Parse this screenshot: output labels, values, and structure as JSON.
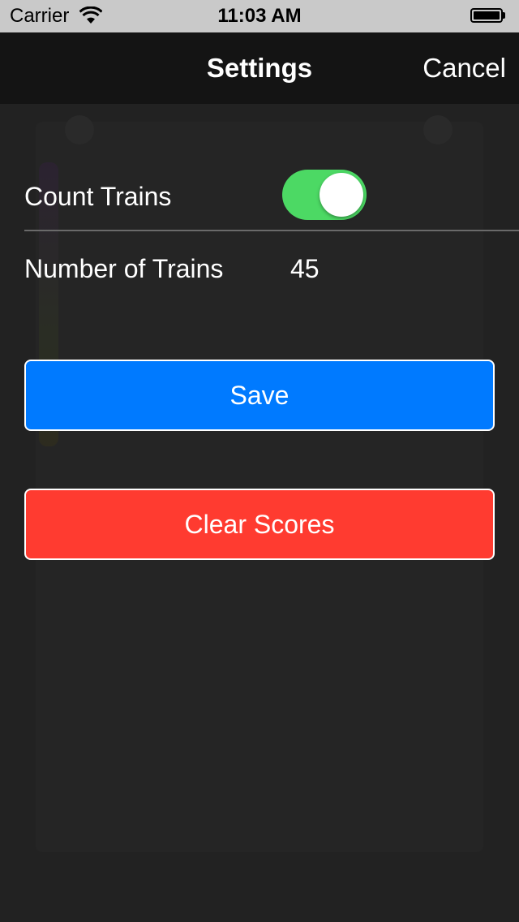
{
  "status_bar": {
    "carrier": "Carrier",
    "time": "11:03 AM",
    "wifi_icon": "wifi-icon",
    "battery_icon": "battery-icon"
  },
  "nav": {
    "title": "Settings",
    "cancel_label": "Cancel"
  },
  "settings": {
    "count_trains_label": "Count Trains",
    "count_trains_on": true,
    "number_of_trains_label": "Number of Trains",
    "number_of_trains_value": "45"
  },
  "buttons": {
    "save_label": "Save",
    "clear_scores_label": "Clear Scores"
  },
  "colors": {
    "save": "#007aff",
    "clear": "#ff3b30",
    "switch_on": "#4cd964",
    "background": "#222222"
  }
}
